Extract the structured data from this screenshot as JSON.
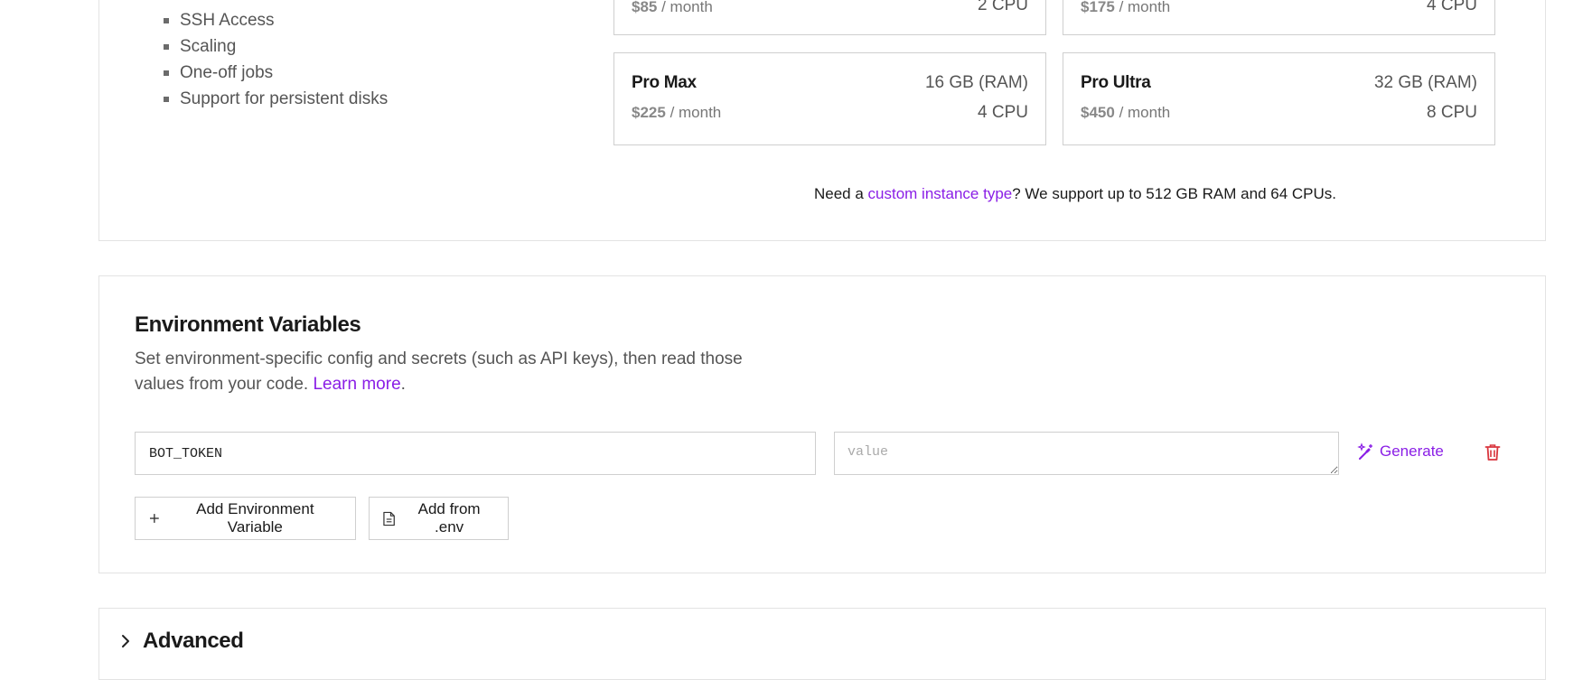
{
  "features": [
    "SSH Access",
    "Scaling",
    "One-off jobs",
    "Support for persistent disks"
  ],
  "instances": [
    {
      "name": "",
      "ram": "",
      "price": "$85",
      "per": "/ month",
      "cpu": "2 CPU"
    },
    {
      "name": "",
      "ram": "",
      "price": "$175",
      "per": "/ month",
      "cpu": "4 CPU"
    },
    {
      "name": "Pro Max",
      "ram": "16 GB (RAM)",
      "price": "$225",
      "per": "/ month",
      "cpu": "4 CPU"
    },
    {
      "name": "Pro Ultra",
      "ram": "32 GB (RAM)",
      "price": "$450",
      "per": "/ month",
      "cpu": "8 CPU"
    }
  ],
  "custom_note": {
    "prefix": "Need a ",
    "link": "custom instance type",
    "suffix": "? We support up to 512 GB RAM and 64 CPUs."
  },
  "env": {
    "title": "Environment Variables",
    "desc_text": "Set environment-specific config and secrets (such as API keys), then read those values from your code. ",
    "learn_more": "Learn more",
    "desc_end": ".",
    "key_value": "BOT_TOKEN",
    "value_placeholder": "value",
    "generate_label": "Generate",
    "add_label": "Add Environment Variable",
    "add_env_label": "Add from .env"
  },
  "advanced": {
    "title": "Advanced"
  },
  "colors": {
    "accent": "#8a1ee6",
    "danger": "#d9363e",
    "border": "#e3e3e3"
  }
}
